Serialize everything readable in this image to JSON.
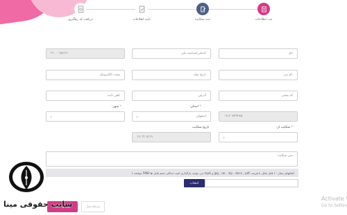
{
  "stepper": {
    "steps": [
      {
        "label": "ثبت اطلاعات",
        "icon": "document-icon",
        "state": "active"
      },
      {
        "label": "ثبت شکایت",
        "icon": "edit-document-icon",
        "state": "done"
      },
      {
        "label": "تایید اطلاعات",
        "icon": "check-document-icon",
        "state": "todo"
      },
      {
        "label": "دریافت کد رهگیری",
        "icon": "tracking-icon",
        "state": "todo"
      }
    ]
  },
  "form": {
    "name_placeholder": "نام",
    "national_code_placeholder": "کدملی/شناسه ملی",
    "phone_value": "۲۱۰۰۰۹۵۱۲۶",
    "last_name_placeholder": "نام پدر",
    "birth_date_placeholder": "تاریخ تولد",
    "email_placeholder": "پست الکترونیک",
    "postal_code_placeholder": "کد پستی",
    "address_placeholder": "آدرس",
    "landline_placeholder": "تلفن ثابت",
    "mobile_value": "۰۹۱۲۰۷۳۳۲۷۵",
    "province_label": "استان:",
    "province_value": "اصفهان",
    "city_label": "شهر:",
    "complaint_type_label": "شکایت از:",
    "complaint_date_label": "تاریخ شکایت",
    "complaint_date_value": "۱۴۰۳/۰۷/۱۹",
    "complaint_text_placeholder": "متن شکایت",
    "attachment_note": "(فایلهای مجاز : ( قابل فایل با فرمت jpg , rar , zip , docx , pdf و mp4 می توانید بارگذاری کنید حداکثر حجم فایل ها 5MB میباشد )",
    "file_button": "انتخاب",
    "next_button": "ثبت و ادامه",
    "prev_button": "مرحله قبل"
  },
  "brand": {
    "text": "سایت حقوقی مینا",
    "logo_icon": "quill-pen-icon"
  },
  "watermark": {
    "line1": "Activate W",
    "line2": "Go to Settings"
  },
  "colors": {
    "accent": "#d43b86",
    "navy": "#2b2d6e",
    "done": "#4e5f86"
  }
}
